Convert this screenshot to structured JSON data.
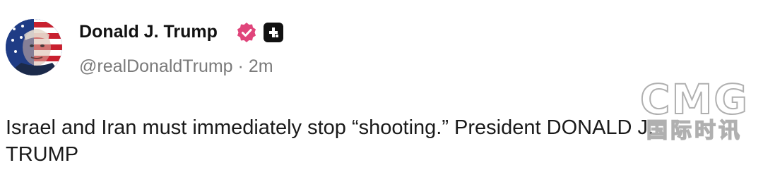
{
  "author": {
    "display_name": "Donald J. Trump",
    "handle": "@realDonaldTrump",
    "separator": "·",
    "time_ago": "2m",
    "verified_badge_color": "#e0457b",
    "avatar_icon": "flag-portrait-avatar"
  },
  "post": {
    "text": "Israel and Iran must immediately stop “shooting.” President DONALD J.\nTRUMP"
  },
  "watermark": {
    "latin": "CMG",
    "cjk": "国际时讯"
  }
}
